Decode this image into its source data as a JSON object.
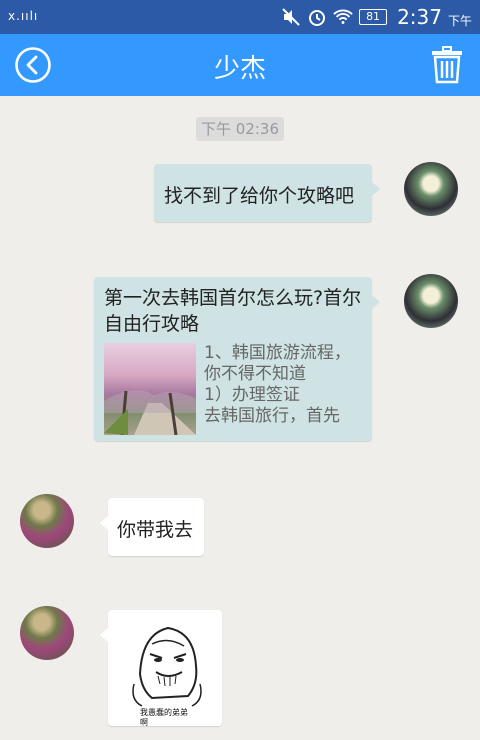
{
  "status_bar": {
    "carrier": "x.ıılı",
    "battery": "81",
    "time": "2:37",
    "ampm": "下午"
  },
  "header": {
    "title": "少杰",
    "back_icon": "back-circle-icon",
    "delete_icon": "trash-icon"
  },
  "chat": {
    "timestamp": "下午 02:36",
    "messages": [
      {
        "from": "me",
        "type": "text",
        "text": "找不到了给你个攻略吧"
      },
      {
        "from": "me",
        "type": "link",
        "title": "第一次去韩国首尔怎么玩?首尔自由行攻略",
        "desc_lines": [
          "1、韩国旅游流程，",
          "你不得不知道",
          "1）办理签证",
          "去韩国旅行，首先"
        ]
      },
      {
        "from": "other",
        "type": "text",
        "text": "你带我去"
      },
      {
        "from": "other",
        "type": "sticker",
        "caption": "我愚蠢的弟弟\n啊"
      }
    ]
  }
}
